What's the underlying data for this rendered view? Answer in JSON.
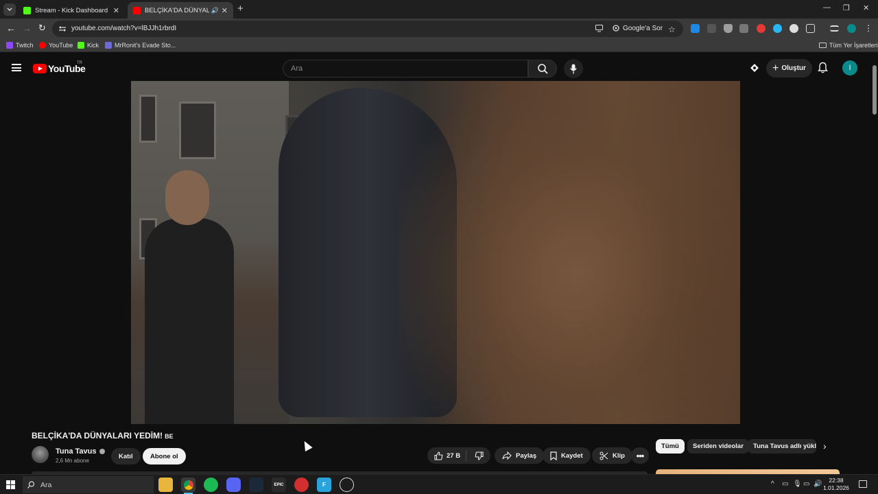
{
  "browser": {
    "tabs": [
      {
        "title": "Stream - Kick Dashboard",
        "favicon_color": "#53fc18"
      },
      {
        "title": "BELÇİKA'DA DÜNYALARI YE",
        "favicon_color": "#ff0000"
      }
    ],
    "url": "youtube.com/watch?v=lBJJh1rbrdI",
    "google_ask_label": "Google'a Sor",
    "bookmarks": [
      {
        "label": "Twitch",
        "color": "#9146ff"
      },
      {
        "label": "YouTube",
        "color": "#ff0000"
      },
      {
        "label": "Kick",
        "color": "#53fc18"
      },
      {
        "label": "MrRonit's Evade Sto...",
        "color": "#6b6bd6"
      }
    ],
    "all_bookmarks_label": "Tüm Yer İşaretleri"
  },
  "youtube": {
    "logo_text": "YouTube",
    "country_code": "TR",
    "search_placeholder": "Ara",
    "create_label": "Oluştur",
    "avatar_letter": "I"
  },
  "video": {
    "title": "BELÇİKA'DA DÜNYALARI YEDİM!",
    "title_tag": "BE",
    "channel_name": "Tuna Tavus",
    "subscribers": "2,6 Mn abone",
    "join_label": "Katıl",
    "subscribe_label": "Abone ol",
    "likes": "27 B",
    "share_label": "Paylaş",
    "save_label": "Kaydet",
    "clip_label": "Klip"
  },
  "chips": [
    {
      "label": "Tümü",
      "active": true
    },
    {
      "label": "Seriden videolar",
      "active": false
    },
    {
      "label": "Tuna Tavus adlı yükleyiciden",
      "active": false
    }
  ],
  "taskbar": {
    "search_label": "Ara",
    "time": "22:38",
    "date": "1.01.2026"
  }
}
